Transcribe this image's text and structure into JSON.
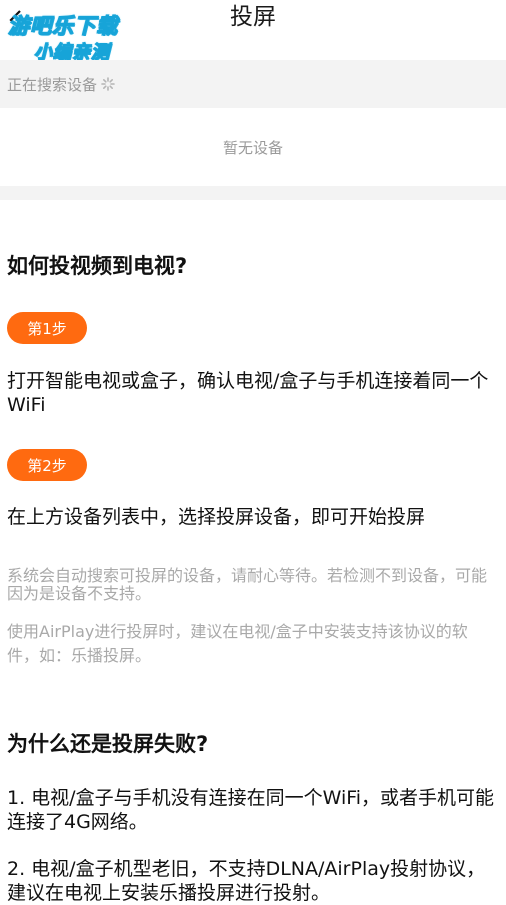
{
  "header": {
    "title": "投屏",
    "back_icon": "chevron-left-icon",
    "watermark_line1": "游吧乐下载",
    "watermark_line2": "小编亲测"
  },
  "search": {
    "status": "正在搜索设备",
    "spinner_icon": "loading-spinner-icon"
  },
  "devices": {
    "empty_text": "暂无设备"
  },
  "guide": {
    "heading": "如何投视频到电视?",
    "step1_label": "第1步",
    "step1_text": "打开智能电视或盒子，确认电视/盒子与手机连接着同一个WiFi",
    "step2_label": "第2步",
    "step2_text": "在上方设备列表中，选择投屏设备，即可开始投屏",
    "note1": "系统会自动搜索可投屏的设备，请耐心等待。若检测不到设备，可能因为是设备不支持。",
    "note2": "使用AirPlay进行投屏时，建议在电视/盒子中安装支持该协议的软件，如：乐播投屏。"
  },
  "faq": {
    "heading": "为什么还是投屏失败?",
    "item1": "1. 电视/盒子与手机没有连接在同一个WiFi，或者手机可能连接了4G网络。",
    "item2": "2. 电视/盒子机型老旧，不支持DLNA/AirPlay投射协议，建议在电视上安装乐播投屏进行投射。"
  },
  "colors": {
    "accent": "#ff6a10",
    "muted_text": "#9a9a9a",
    "section_bg": "#f3f3f3"
  }
}
